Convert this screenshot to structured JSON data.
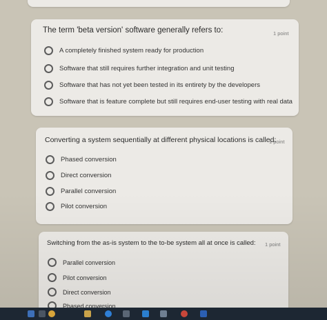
{
  "questions": [
    {
      "title": "The term 'beta version' software generally refers to:",
      "points": "1 point",
      "options": [
        "A completely finished system ready for production",
        "Software that still requires further integration and unit testing",
        "Software that has not yet been tested in its entirety by the developers",
        "Software that is feature complete but still requires end-user testing with real data"
      ]
    },
    {
      "title": "Converting a system sequentially at different physical locations is called:",
      "points": "1 point",
      "options": [
        "Phased conversion",
        "Direct conversion",
        "Parallel conversion",
        "Pilot conversion"
      ]
    },
    {
      "title": "Switching from the as-is system to the to-be system all at once is called:",
      "points": "1 point",
      "options": [
        "Parallel conversion",
        "Pilot conversion",
        "Direct conversion",
        "Phased conversion"
      ]
    }
  ],
  "taskbar": {
    "icons": [
      "windows-icon",
      "search-icon",
      "chrome-icon",
      "file-explorer-icon",
      "edge-icon",
      "store-icon",
      "mail-icon",
      "photos-icon",
      "chrome-profile-icon",
      "word-icon"
    ],
    "colors": {
      "background": "#1d2733",
      "accent": "#2b5fb3"
    }
  }
}
